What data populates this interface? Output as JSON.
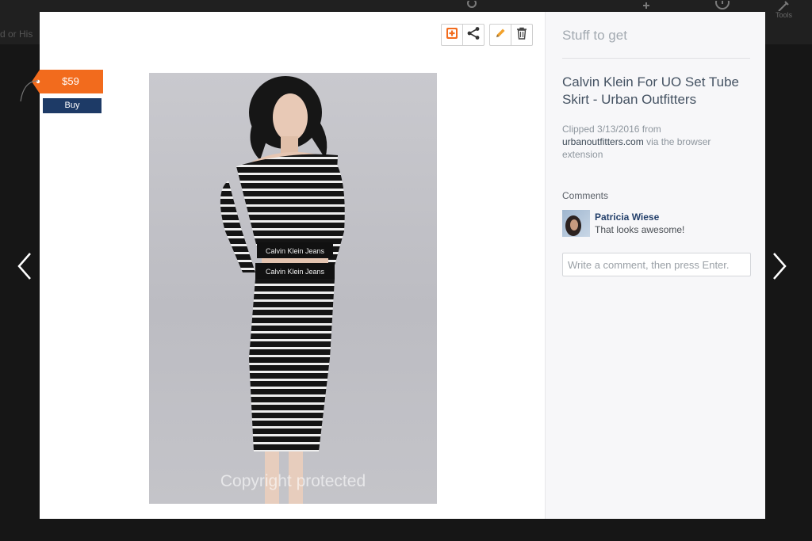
{
  "backdrop": {
    "left_fragment": "d or His",
    "tools_label": "Tools"
  },
  "toolbar": {
    "add_icon": "add-to-board-icon",
    "share_icon": "share-icon",
    "edit_icon": "pencil-icon",
    "delete_icon": "trash-icon"
  },
  "photo": {
    "watermark": "Copyright protected",
    "waistband_text": "Calvin Klein Jeans"
  },
  "price_tag": {
    "price": "$59",
    "buy_label": "Buy",
    "color": "#f26b1d"
  },
  "sidebar": {
    "board_name": "Stuff to get",
    "item_title": "Calvin Klein For UO Set Tube Skirt - Urban Outfitters",
    "clip": {
      "prefix": "Clipped 3/13/2016 from",
      "source_link": "urbanoutfitters.com",
      "suffix": "via the browser extension"
    },
    "comments_label": "Comments",
    "comments": [
      {
        "author": "Patricia Wiese",
        "text": "That looks awesome!"
      }
    ],
    "comment_placeholder": "Write a comment, then press Enter."
  },
  "navigation": {
    "prev_icon": "chevron-left-icon",
    "next_icon": "chevron-right-icon"
  }
}
